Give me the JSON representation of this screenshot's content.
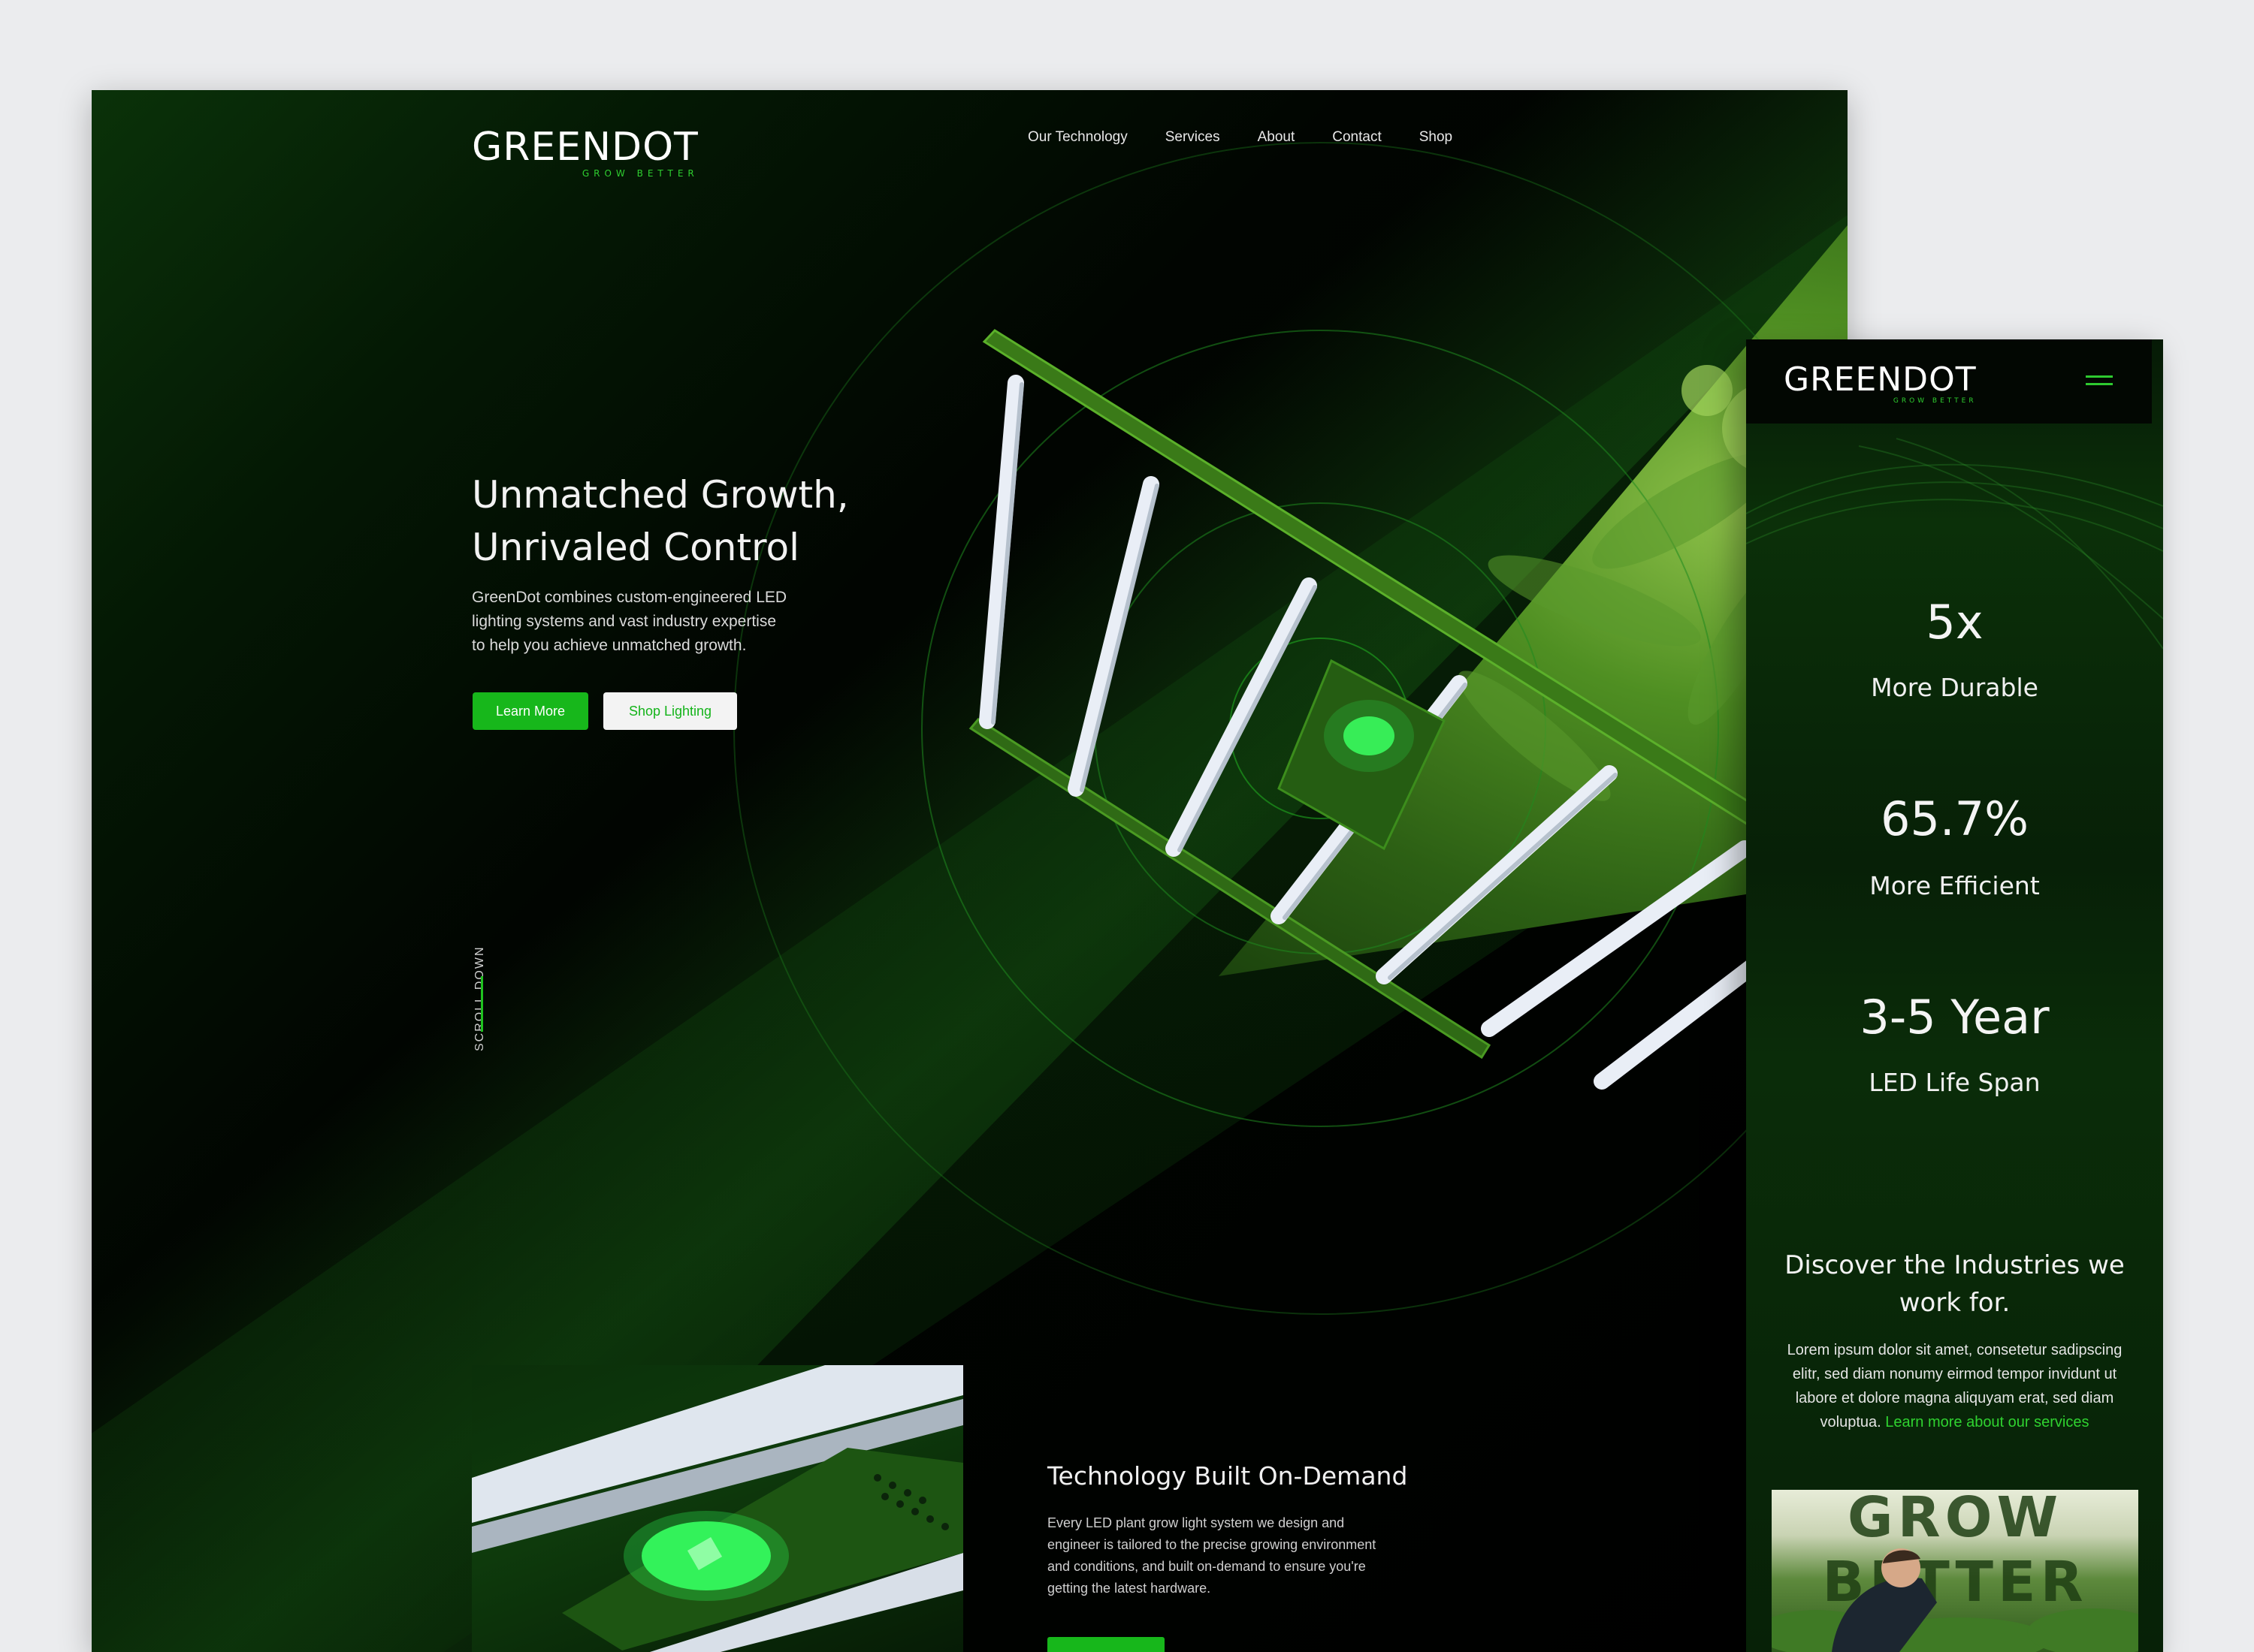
{
  "desktop": {
    "logo": {
      "text": "GREENDOT",
      "tagline": "GROW BETTER"
    },
    "nav": [
      "Our Technology",
      "Services",
      "About",
      "Contact",
      "Shop"
    ],
    "hero": {
      "title_line1": "Unmatched Growth,",
      "title_line2": "Unrivaled Control",
      "copy_line1": "GreenDot combines custom-engineered LED",
      "copy_line2": "lighting systems and vast industry expertise",
      "copy_line3": "to help you achieve unmatched growth.",
      "primary_button": "Learn More",
      "secondary_button": "Shop Lighting"
    },
    "scroll_label": "SCROLL DOWN",
    "technology": {
      "title": "Technology Built On-Demand",
      "copy_line1": "Every LED plant grow light system we design and",
      "copy_line2": "engineer is tailored to the precise growing environment",
      "copy_line3": "and conditions, and built on-demand to ensure you're",
      "copy_line4": "getting the latest hardware."
    }
  },
  "mobile": {
    "logo": {
      "text": "GREENDOT",
      "tagline": "GROW BETTER"
    },
    "stats": [
      {
        "value": "5x",
        "label": "More Durable"
      },
      {
        "value": "65.7%",
        "label": "More Efficient"
      },
      {
        "value": "3-5 Year",
        "label": "LED Life Span"
      }
    ],
    "industries": {
      "title_line1": "Discover the Industries we",
      "title_line2": "work for.",
      "copy_line1": "Lorem ipsum dolor sit amet, consetetur sadipscing",
      "copy_line2": "elitr, sed diam nonumy eirmod tempor invidunt ut",
      "copy_line3": "labore et dolore magna aliquyam erat, sed diam",
      "copy_line4": "voluptua.",
      "link": "Learn more about our services"
    },
    "photo_text": "GROW BETTER"
  },
  "colors": {
    "accent": "#17b71b",
    "background": "#000000",
    "page": "#ebecee"
  },
  "icons": [
    "logo-mark-icon",
    "hamburger-menu-icon"
  ]
}
